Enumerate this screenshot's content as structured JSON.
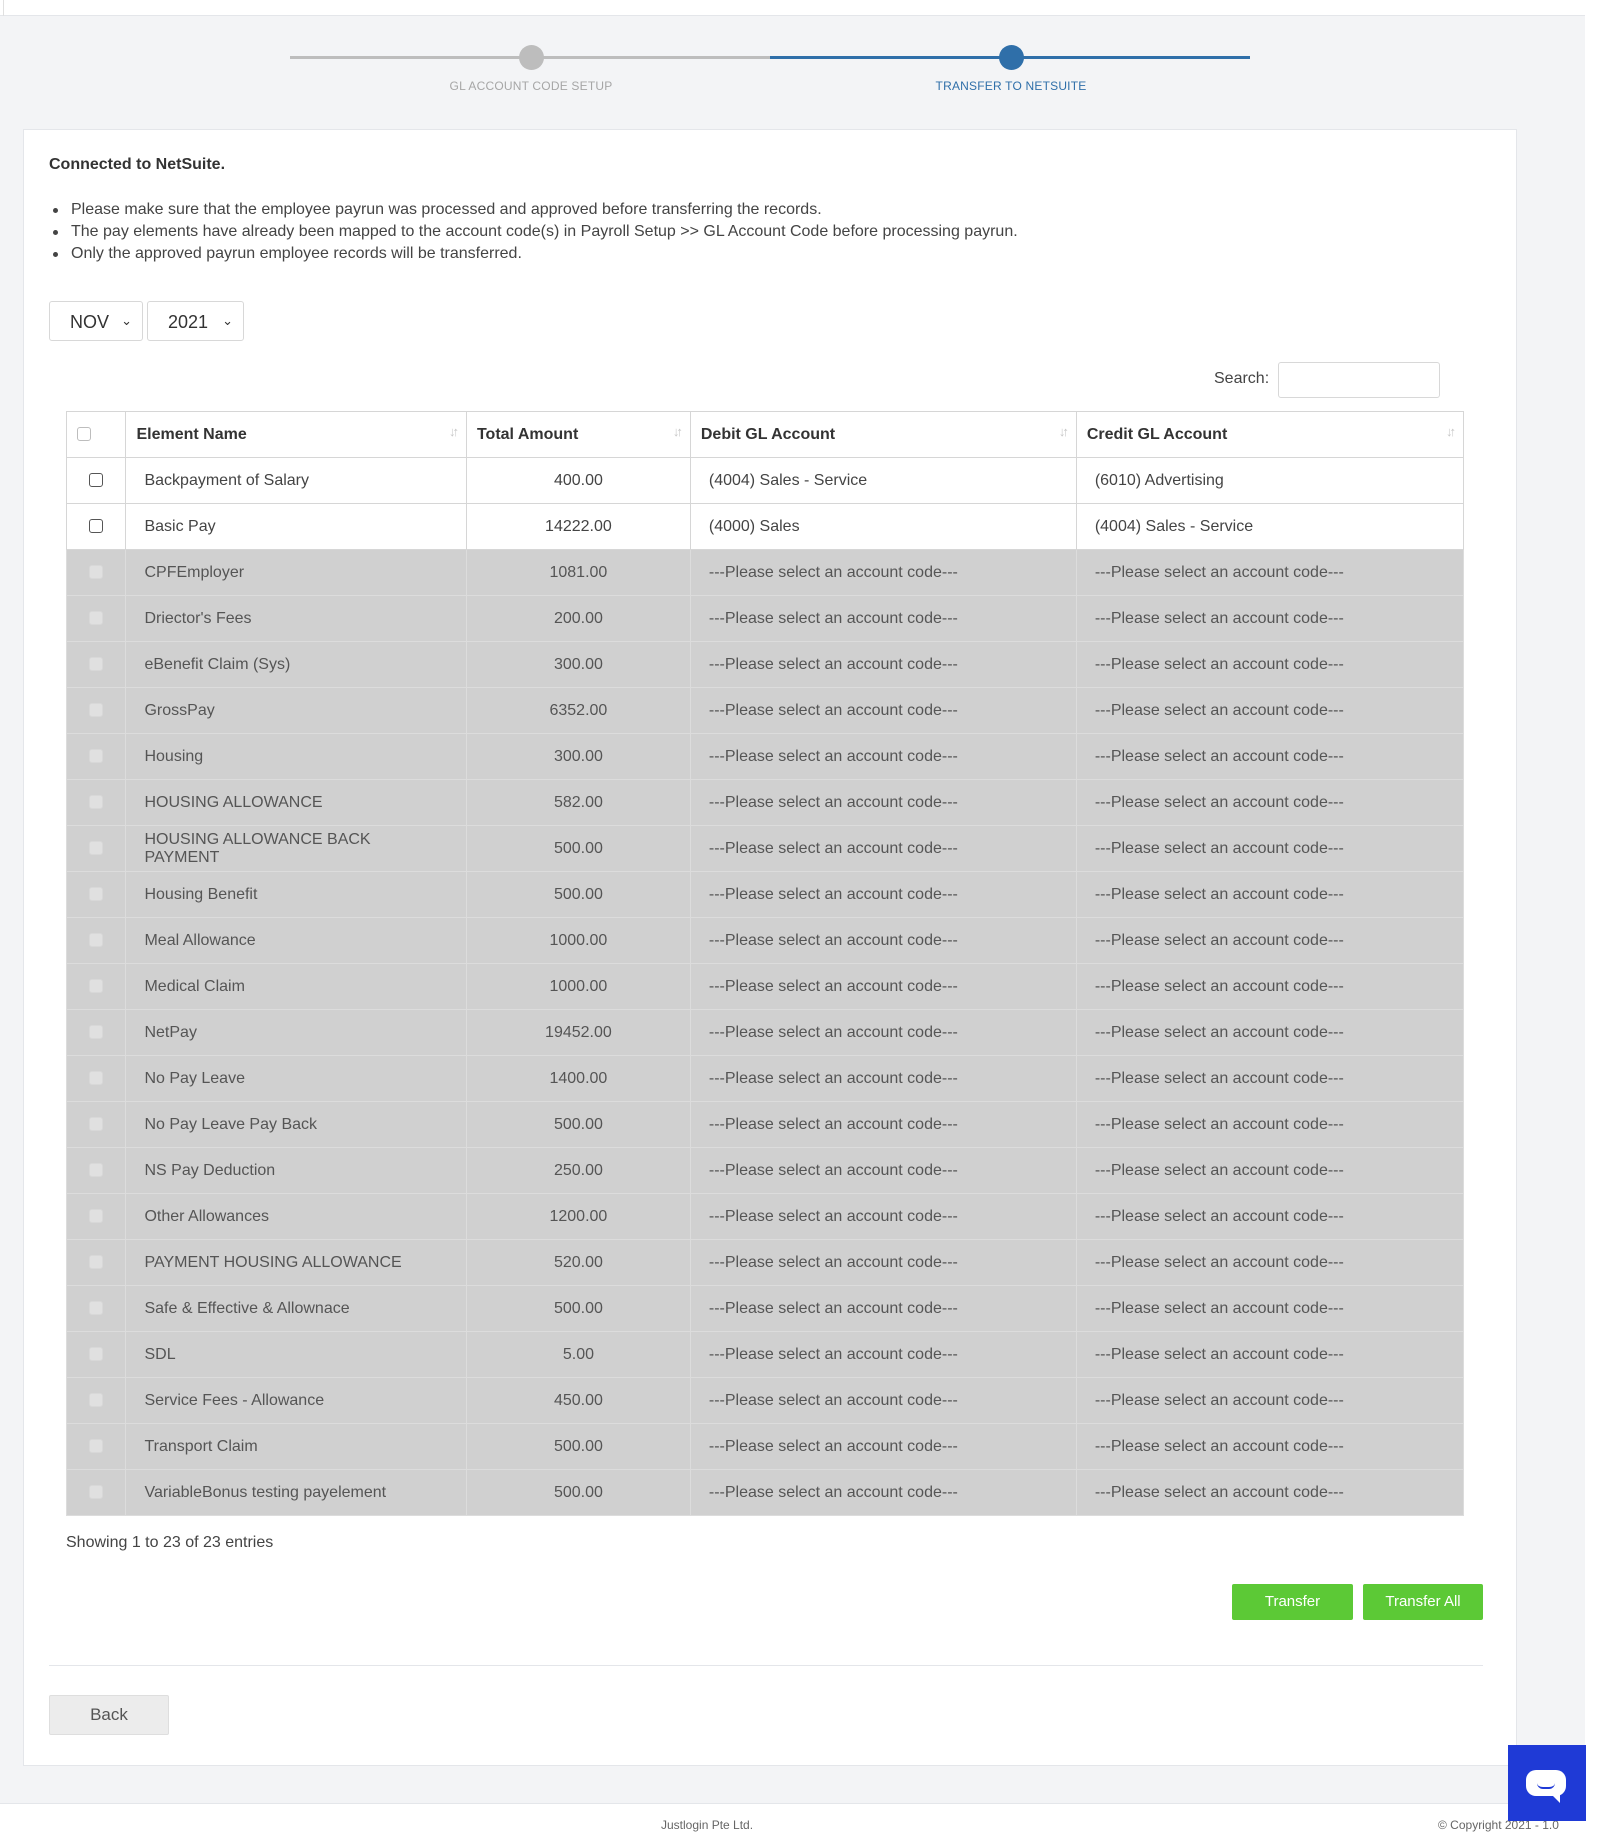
{
  "stepper": {
    "step1_label": "GL ACCOUNT CODE SETUP",
    "step2_label": "TRANSFER TO NETSUITE",
    "active_step": 2
  },
  "status_text": "Connected to NetSuite.",
  "notes": [
    "Please make sure that the employee payrun was processed and approved before transferring the records.",
    "The pay elements have already been mapped to the account code(s) in Payroll Setup >> GL Account Code before processing payrun.",
    "Only the approved payrun employee records will be transferred."
  ],
  "filters": {
    "month": "NOV",
    "year": "2021"
  },
  "search": {
    "label": "Search:",
    "value": ""
  },
  "table": {
    "headers": [
      "Element Name",
      "Total Amount",
      "Debit GL Account",
      "Credit GL Account"
    ],
    "rows": [
      {
        "name": "Backpayment of Salary",
        "amount": "400.00",
        "debit": "(4004) Sales - Service",
        "credit": "(6010) Advertising",
        "enabled": true
      },
      {
        "name": "Basic Pay",
        "amount": "14222.00",
        "debit": "(4000) Sales",
        "credit": "(4004) Sales - Service",
        "enabled": true
      },
      {
        "name": "CPFEmployer",
        "amount": "1081.00",
        "debit": "---Please select an account code---",
        "credit": "---Please select an account code---",
        "enabled": false
      },
      {
        "name": "Driector's Fees",
        "amount": "200.00",
        "debit": "---Please select an account code---",
        "credit": "---Please select an account code---",
        "enabled": false
      },
      {
        "name": "eBenefit Claim (Sys)",
        "amount": "300.00",
        "debit": "---Please select an account code---",
        "credit": "---Please select an account code---",
        "enabled": false
      },
      {
        "name": "GrossPay",
        "amount": "6352.00",
        "debit": "---Please select an account code---",
        "credit": "---Please select an account code---",
        "enabled": false
      },
      {
        "name": "Housing",
        "amount": "300.00",
        "debit": "---Please select an account code---",
        "credit": "---Please select an account code---",
        "enabled": false
      },
      {
        "name": "HOUSING ALLOWANCE",
        "amount": "582.00",
        "debit": "---Please select an account code---",
        "credit": "---Please select an account code---",
        "enabled": false
      },
      {
        "name": "HOUSING ALLOWANCE BACK PAYMENT",
        "amount": "500.00",
        "debit": "---Please select an account code---",
        "credit": "---Please select an account code---",
        "enabled": false
      },
      {
        "name": "Housing Benefit",
        "amount": "500.00",
        "debit": "---Please select an account code---",
        "credit": "---Please select an account code---",
        "enabled": false
      },
      {
        "name": "Meal Allowance",
        "amount": "1000.00",
        "debit": "---Please select an account code---",
        "credit": "---Please select an account code---",
        "enabled": false
      },
      {
        "name": "Medical Claim",
        "amount": "1000.00",
        "debit": "---Please select an account code---",
        "credit": "---Please select an account code---",
        "enabled": false
      },
      {
        "name": "NetPay",
        "amount": "19452.00",
        "debit": "---Please select an account code---",
        "credit": "---Please select an account code---",
        "enabled": false
      },
      {
        "name": "No Pay Leave",
        "amount": "1400.00",
        "debit": "---Please select an account code---",
        "credit": "---Please select an account code---",
        "enabled": false
      },
      {
        "name": "No Pay Leave Pay Back",
        "amount": "500.00",
        "debit": "---Please select an account code---",
        "credit": "---Please select an account code---",
        "enabled": false
      },
      {
        "name": "NS Pay Deduction",
        "amount": "250.00",
        "debit": "---Please select an account code---",
        "credit": "---Please select an account code---",
        "enabled": false
      },
      {
        "name": "Other Allowances",
        "amount": "1200.00",
        "debit": "---Please select an account code---",
        "credit": "---Please select an account code---",
        "enabled": false
      },
      {
        "name": "PAYMENT HOUSING ALLOWANCE",
        "amount": "520.00",
        "debit": "---Please select an account code---",
        "credit": "---Please select an account code---",
        "enabled": false
      },
      {
        "name": "Safe & Effective & Allownace",
        "amount": "500.00",
        "debit": "---Please select an account code---",
        "credit": "---Please select an account code---",
        "enabled": false
      },
      {
        "name": "SDL",
        "amount": "5.00",
        "debit": "---Please select an account code---",
        "credit": "---Please select an account code---",
        "enabled": false
      },
      {
        "name": "Service Fees - Allowance",
        "amount": "450.00",
        "debit": "---Please select an account code---",
        "credit": "---Please select an account code---",
        "enabled": false
      },
      {
        "name": "Transport Claim",
        "amount": "500.00",
        "debit": "---Please select an account code---",
        "credit": "---Please select an account code---",
        "enabled": false
      },
      {
        "name": "VariableBonus testing payelement",
        "amount": "500.00",
        "debit": "---Please select an account code---",
        "credit": "---Please select an account code---",
        "enabled": false
      }
    ]
  },
  "showing_text": "Showing 1 to 23 of 23 entries",
  "buttons": {
    "transfer": "Transfer",
    "transfer_all": "Transfer All",
    "back": "Back"
  },
  "footer": {
    "company": "Justlogin Pte Ltd.",
    "copyright": "© Copyright 2021 - 1.0"
  },
  "colors": {
    "accent_blue": "#2f6fa9",
    "green": "#5cc936",
    "disabled_row": "#d0d0d0",
    "chat_blue": "#1f3ad6"
  },
  "icons": {
    "sort": "sort-arrows-icon",
    "chevron": "chevron-down-icon",
    "chat": "chat-bubble-icon"
  }
}
